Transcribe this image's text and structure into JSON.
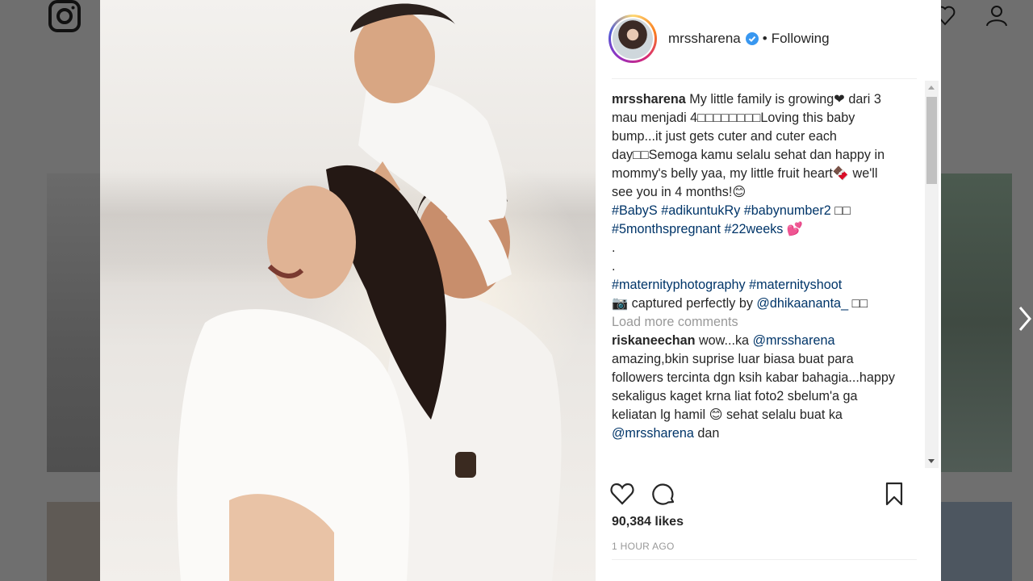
{
  "post": {
    "username": "mrssharena",
    "separator": "•",
    "follow_status": "Following",
    "caption": {
      "username": "mrssharena",
      "text": "My little family is growing❤ dari 3 mau menjadi 4□□□□□□□□Loving this baby bump...it just gets cuter and cuter each day□□Semoga kamu selalu sehat dan happy in mommy's belly yaa, my little fruit heart🍫 we'll see you in 4 months!😊",
      "hashtags_1": [
        "#BabyS",
        "#adikuntukRy",
        "#babynumber2"
      ],
      "hashtags_1_suffix": "□□",
      "hashtags_2": [
        "#5monthspregnant",
        "#22weeks"
      ],
      "hashtags_2_suffix": "💕",
      "dot_1": ".",
      "dot_2": ".",
      "hashtags_3": [
        "#maternityphotography",
        "#maternityshoot"
      ],
      "credit_prefix": "📷 captured perfectly by",
      "credit_mention": "@dhikaananta_",
      "credit_suffix": "□□"
    },
    "load_more": "Load more comments",
    "comment": {
      "username": "riskaneechan",
      "text_1": "wow...ka",
      "mention": "@mrssharena",
      "text_2": "amazing,bkin suprise luar biasa buat para followers tercinta dgn ksih kabar bahagia...happy sekaligus kaget krna liat foto2 sbelum'a ga keliatan lg hamil",
      "text_3": "😊 sehat selalu buat ka",
      "mention_2": "@mrssharena",
      "text_4": "dan"
    },
    "likes": "90,384 likes",
    "timestamp": "1 HOUR AGO"
  },
  "icons": {
    "brand": "instagram-icon",
    "like": "heart-icon",
    "comment": "comment-icon",
    "save": "bookmark-icon",
    "next": "chevron-right-icon",
    "verified": "verified-badge-icon"
  },
  "colors": {
    "hashtag": "#003569",
    "verified": "#3897f0",
    "muted": "#999999"
  }
}
